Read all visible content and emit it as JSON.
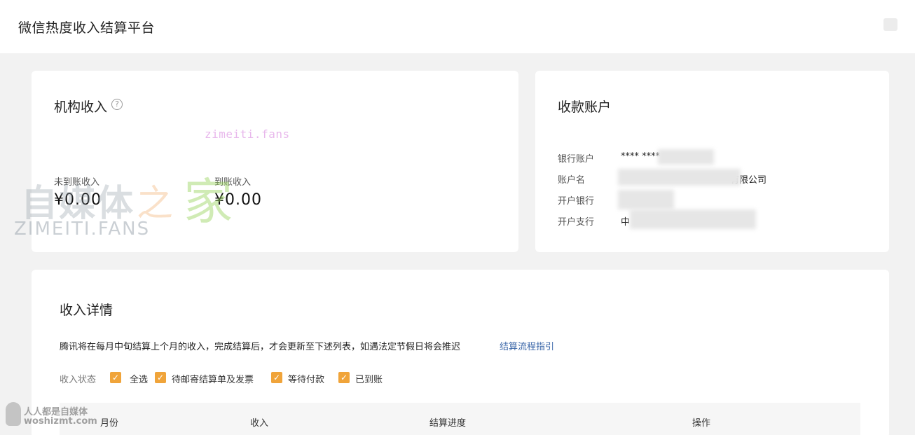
{
  "header": {
    "title": "微信热度收入结算平台"
  },
  "income_card": {
    "title": "机构收入",
    "help": "?",
    "watermark": "zimeiti.fans",
    "pending_label": "未到账收入",
    "pending_value": "¥0.00",
    "received_label": "到账收入",
    "received_value": "¥0.00"
  },
  "account_card": {
    "title": "收款账户",
    "rows": [
      {
        "label": "银行账户",
        "value": "**** ****"
      },
      {
        "label": "账户名",
        "value": "有限公司"
      },
      {
        "label": "开户银行",
        "value": ""
      },
      {
        "label": "开户支行",
        "value": "中"
      }
    ]
  },
  "detail_card": {
    "title": "收入详情",
    "notice": "腾讯将在每月中旬结算上个月的收入，完成结算后，才会更新至下述列表，如遇法定节假日将会推迟",
    "notice_link": "结算流程指引",
    "filter_label": "收入状态",
    "filters": [
      {
        "label": "全选",
        "checked": true
      },
      {
        "label": "待邮寄结算单及发票",
        "checked": true
      },
      {
        "label": "等待付款",
        "checked": true
      },
      {
        "label": "已到账",
        "checked": true
      }
    ],
    "columns": [
      "月份",
      "收入",
      "结算进度",
      "操作"
    ]
  },
  "watermarks": {
    "big": "自媒体",
    "zhi": "之",
    "jia": "家",
    "fans": "ZIMEITI.FANS",
    "bottom1": "人人都是自媒体",
    "bottom2": "woshizmt.com"
  },
  "colors": {
    "checkbox": "#f0a43a",
    "link": "#3a66a8",
    "background": "#f2f2f2"
  }
}
